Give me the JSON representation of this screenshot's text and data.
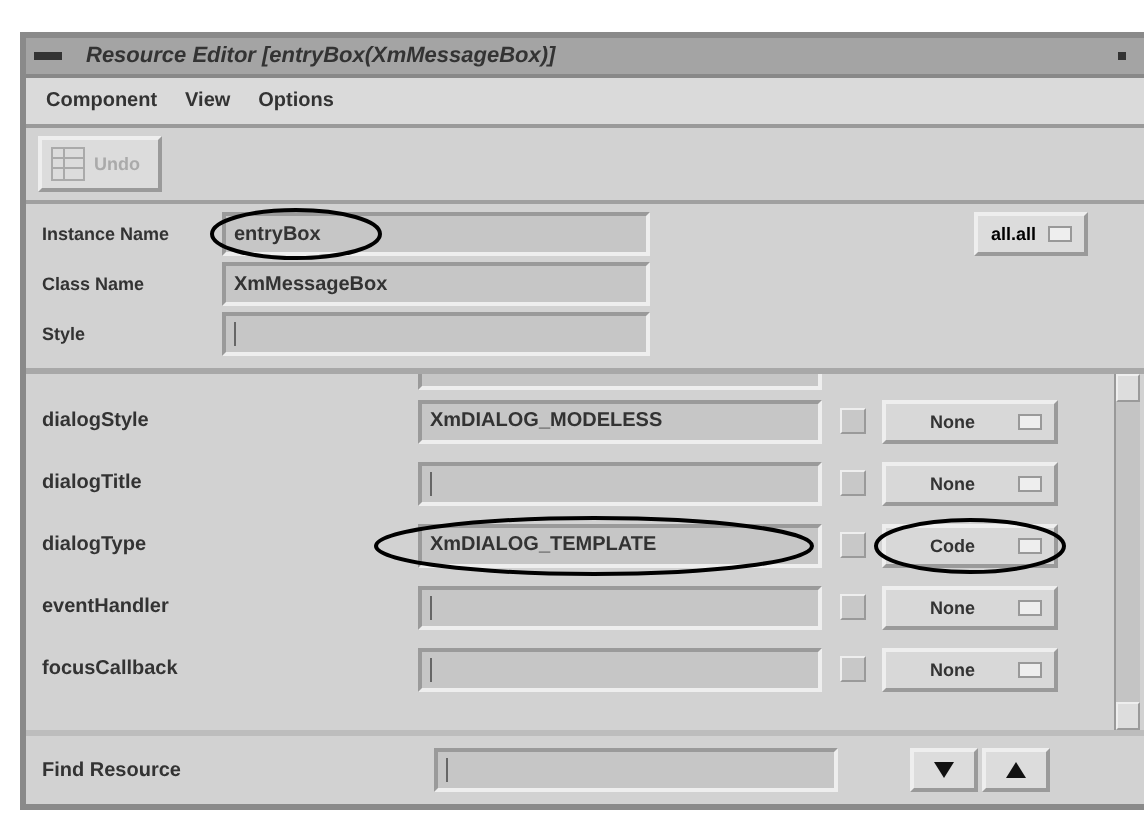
{
  "window": {
    "title": "Resource Editor [entryBox(XmMessageBox)]"
  },
  "menu": [
    "Component",
    "View",
    "Options"
  ],
  "toolbar": [
    {
      "label": "Undo",
      "disabled": true
    }
  ],
  "header_fields": [
    {
      "label": "Instance Name",
      "value": "entryBox",
      "highlighted": true
    },
    {
      "label": "Class Name",
      "value": "XmMessageBox",
      "highlighted": false
    },
    {
      "label": "Style",
      "highlighted": false
    }
  ],
  "scope_button": "all.all",
  "resources": [
    {
      "name": "dialogStyle",
      "value": "XmDIALOG_MODELESS",
      "highlighted": false,
      "option": "None",
      "option_highlighted": false
    },
    {
      "name": "dialogTitle",
      "highlighted": false,
      "option": "None",
      "option_highlighted": false
    },
    {
      "name": "dialogType",
      "value": "XmDIALOG_TEMPLATE",
      "highlighted": true,
      "option": "Code",
      "option_highlighted": true
    },
    {
      "name": "eventHandler",
      "highlighted": false,
      "option": "None",
      "option_highlighted": false
    },
    {
      "name": "focusCallback",
      "highlighted": false,
      "option": "None",
      "option_highlighted": false
    }
  ],
  "find": {
    "label": "Find Resource"
  }
}
